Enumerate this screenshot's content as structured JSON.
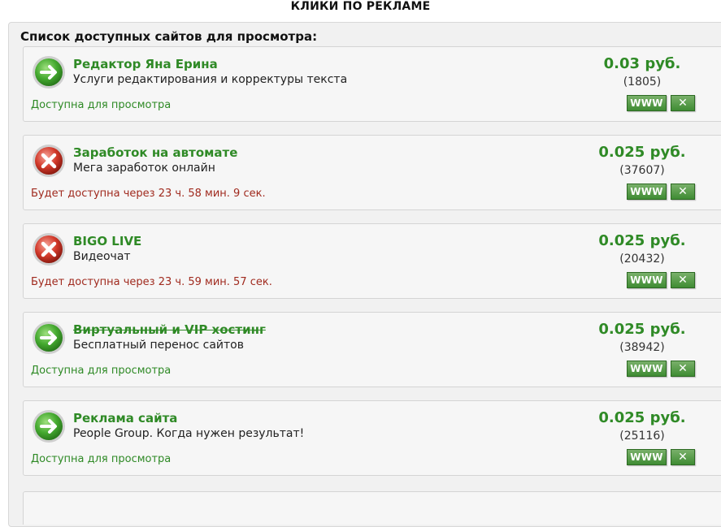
{
  "header": {
    "title": "КЛИКИ ПО РЕКЛАМЕ"
  },
  "panel": {
    "title": "Список доступных сайтов для просмотра:"
  },
  "buttons": {
    "www_label": "WWW",
    "close_label": "✕"
  },
  "colors": {
    "green": "#2f8a26",
    "wait_red": "#a02a1e"
  },
  "cards": [
    {
      "title": "Редактор Яна Ерина",
      "description": "Услуги редактирования и корректуры текста",
      "price": "0.03 руб.",
      "views": "(1805)",
      "status": "Доступна для просмотра",
      "state": "available",
      "icon": "green-arrow-icon"
    },
    {
      "title": "Заработок на автомате",
      "description": "Мега заработок онлайн",
      "price": "0.025 руб.",
      "views": "(37607)",
      "status": "Будет доступна через 23 ч. 58 мин. 9 сек.",
      "state": "waiting",
      "icon": "red-x-icon"
    },
    {
      "title": "BIGO LIVE",
      "description": "Видеочат",
      "price": "0.025 руб.",
      "views": "(20432)",
      "status": "Будет доступна через 23 ч. 59 мин. 57 сек.",
      "state": "waiting",
      "icon": "red-x-icon"
    },
    {
      "title": "Виртуальный и VIP хостинг",
      "description": "Бесплатный перенос сайтов",
      "price": "0.025 руб.",
      "views": "(38942)",
      "status": "Доступна для просмотра",
      "state": "available",
      "icon": "green-arrow-icon"
    },
    {
      "title": "Реклама сайта",
      "description": "People Group. Когда нужен результат!",
      "price": "0.025 руб.",
      "views": "(25116)",
      "status": "Доступна для просмотра",
      "state": "available",
      "icon": "green-arrow-icon"
    }
  ]
}
